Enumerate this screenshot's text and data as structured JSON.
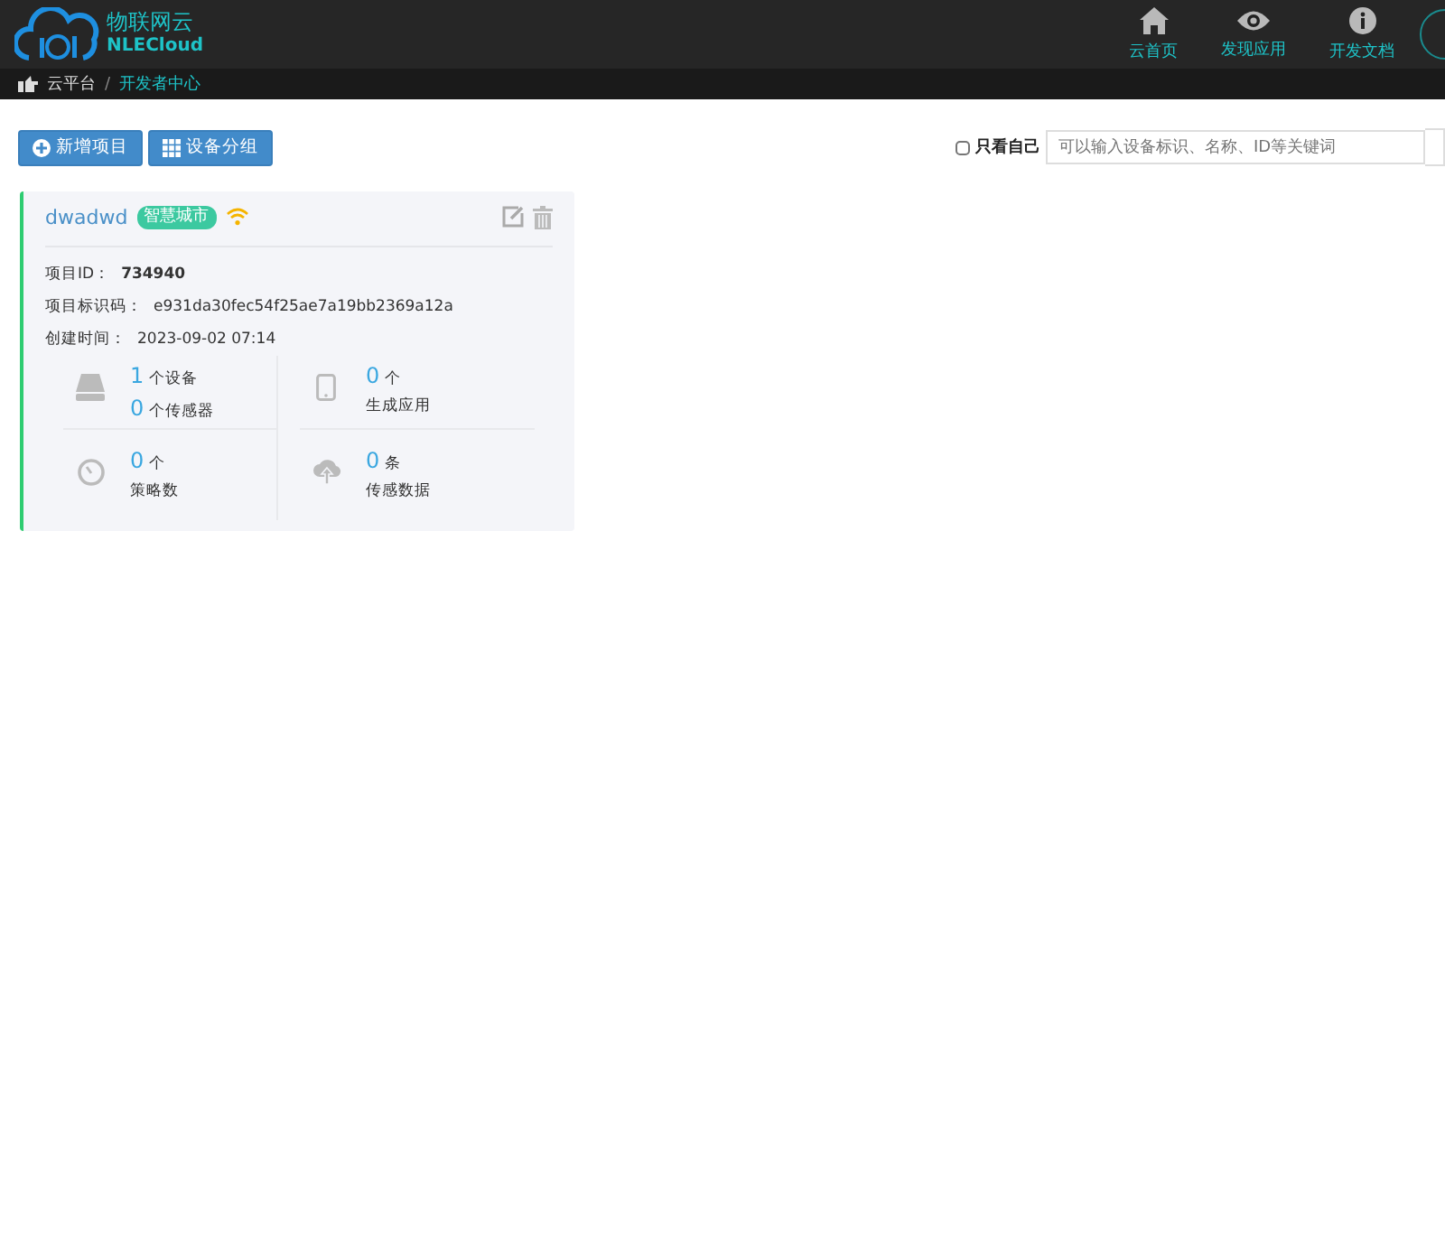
{
  "logo": {
    "title": "物联网云",
    "subtitle": "NLECloud"
  },
  "nav": [
    {
      "label": "云首页",
      "kind": "home"
    },
    {
      "label": "发现应用",
      "kind": "eye"
    },
    {
      "label": "开发文档",
      "kind": "info"
    }
  ],
  "breadcrumb": [
    "云平台",
    "开发者中心"
  ],
  "breadcrumb_separator": "/",
  "toolbar": {
    "buttons": [
      {
        "label": "新增项目",
        "kind": "plus"
      },
      {
        "label": "设备分组",
        "kind": "grid"
      }
    ],
    "only_mine": {
      "label": "只看自己",
      "checked": false
    },
    "search": {
      "placeholder": "可以输入设备标识、名称、ID等关键词"
    }
  },
  "project": {
    "name": "dwadwd",
    "tag": "智慧城市",
    "online": true,
    "fields": [
      {
        "label": "项目ID：",
        "value": "734940",
        "bold": true
      },
      {
        "label": "项目标识码：",
        "value": "e931da30fec54f25ae7a19bb2369a12a",
        "bold": false
      },
      {
        "label": "创建时间：",
        "value": "2023-09-02 07:14",
        "bold": false
      }
    ],
    "stats": [
      {
        "kind": "device",
        "lines": [
          {
            "count": "1",
            "unit": "个设备"
          },
          {
            "count": "0",
            "unit": "个传感器"
          }
        ]
      },
      {
        "kind": "phone",
        "lines": [
          {
            "count": "0",
            "unit": "个"
          },
          {
            "unit": "生成应用"
          }
        ]
      },
      {
        "kind": "gauge",
        "lines": [
          {
            "count": "0",
            "unit": "个"
          },
          {
            "unit": "策略数"
          }
        ]
      },
      {
        "kind": "cloud",
        "lines": [
          {
            "count": "0",
            "unit": "条"
          },
          {
            "unit": "传感数据"
          }
        ]
      }
    ]
  }
}
